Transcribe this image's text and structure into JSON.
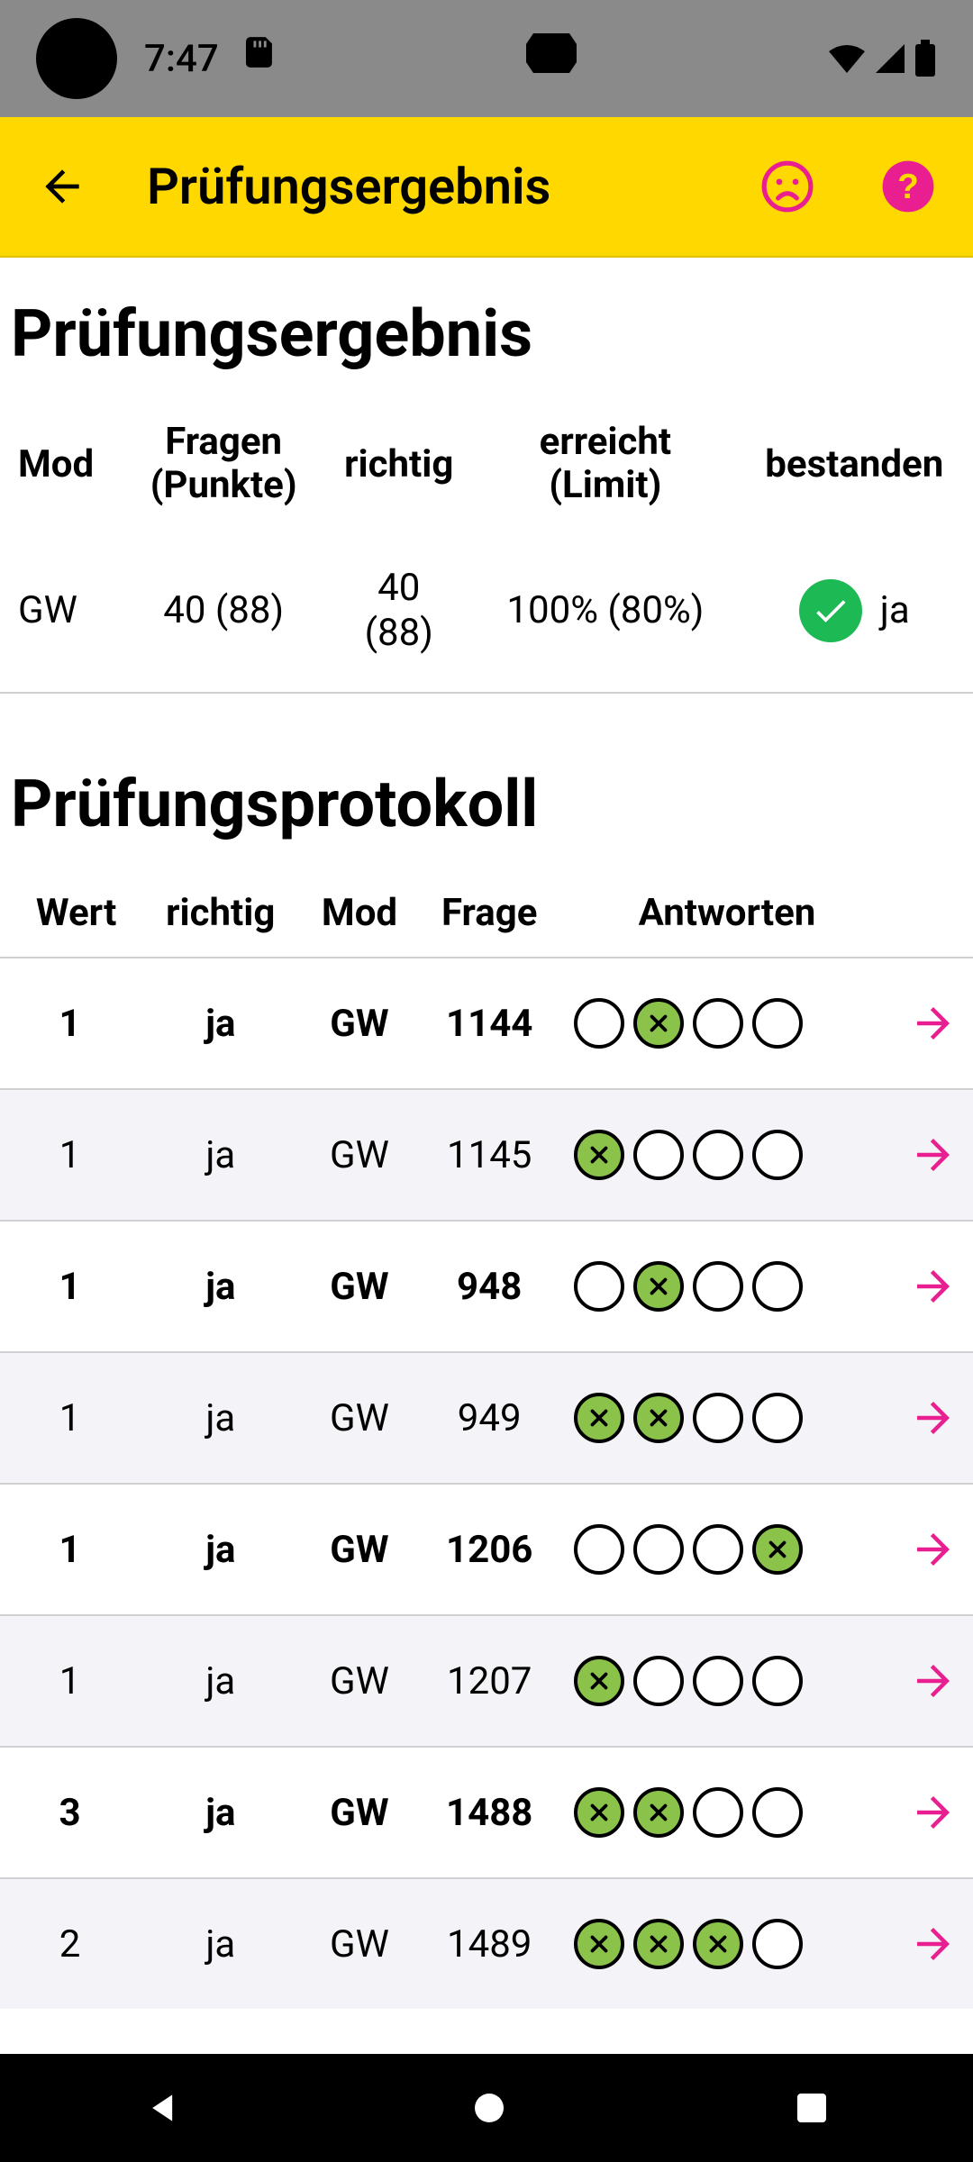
{
  "status_bar": {
    "clock": "7:47"
  },
  "app_bar": {
    "title": "Prüfungsergebnis"
  },
  "page": {
    "heading": "Prüfungsergebnis",
    "protocol_heading": "Prüfungsprotokoll"
  },
  "summary": {
    "columns": {
      "mod": "Mod",
      "fragen_l1": "Fragen",
      "fragen_l2": "(Punkte)",
      "richtig": "richtig",
      "erreicht_l1": "erreicht",
      "erreicht_l2": "(Limit)",
      "bestanden": "bestanden"
    },
    "row": {
      "mod": "GW",
      "fragen": "40 (88)",
      "richtig_l1": "40",
      "richtig_l2": "(88)",
      "erreicht": "100% (80%)",
      "bestanden": "ja"
    }
  },
  "protocol": {
    "columns": {
      "wert": "Wert",
      "richtig": "richtig",
      "mod": "Mod",
      "frage": "Frage",
      "antworten": "Antworten"
    },
    "rows": [
      {
        "wert": "1",
        "richtig": "ja",
        "mod": "GW",
        "frage": "1144",
        "answers": [
          false,
          true,
          false,
          false
        ]
      },
      {
        "wert": "1",
        "richtig": "ja",
        "mod": "GW",
        "frage": "1145",
        "answers": [
          true,
          false,
          false,
          false
        ]
      },
      {
        "wert": "1",
        "richtig": "ja",
        "mod": "GW",
        "frage": "948",
        "answers": [
          false,
          true,
          false,
          false
        ]
      },
      {
        "wert": "1",
        "richtig": "ja",
        "mod": "GW",
        "frage": "949",
        "answers": [
          true,
          true,
          false,
          false
        ]
      },
      {
        "wert": "1",
        "richtig": "ja",
        "mod": "GW",
        "frage": "1206",
        "answers": [
          false,
          false,
          false,
          true
        ]
      },
      {
        "wert": "1",
        "richtig": "ja",
        "mod": "GW",
        "frage": "1207",
        "answers": [
          true,
          false,
          false,
          false
        ]
      },
      {
        "wert": "3",
        "richtig": "ja",
        "mod": "GW",
        "frage": "1488",
        "answers": [
          true,
          true,
          false,
          false
        ]
      },
      {
        "wert": "2",
        "richtig": "ja",
        "mod": "GW",
        "frage": "1489",
        "answers": [
          true,
          true,
          true,
          false
        ]
      }
    ]
  },
  "colors": {
    "accent": "#ffd800",
    "correct_green": "#8bc34a",
    "pass_green": "#1db954",
    "arrow": "#e91e90"
  }
}
